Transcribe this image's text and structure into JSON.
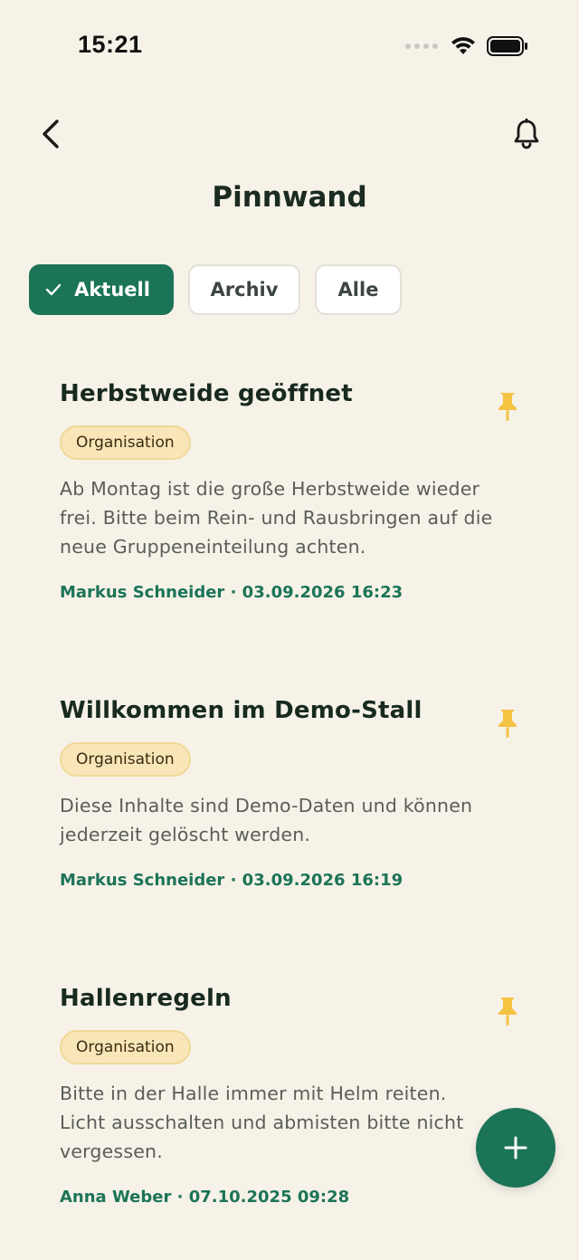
{
  "status_bar": {
    "time": "15:21"
  },
  "nav": {
    "title": "Pinnwand"
  },
  "filters": [
    {
      "label": "Aktuell",
      "selected": true
    },
    {
      "label": "Archiv",
      "selected": false
    },
    {
      "label": "Alle",
      "selected": false
    }
  ],
  "posts": [
    {
      "title": "Herbstweide geöffnet",
      "tag": "Organisation",
      "body": "Ab Montag ist die große Herbstweide wieder frei. Bitte beim Rein- und Rausbringen auf die neue Gruppeneinteilung achten.",
      "meta": "Markus Schneider · 03.09.2026 16:23",
      "pinned": true
    },
    {
      "title": "Willkommen im Demo-Stall",
      "tag": "Organisation",
      "body": "Diese Inhalte sind Demo-Daten und können jederzeit gelöscht werden.",
      "meta": "Markus Schneider · 03.09.2026 16:19",
      "pinned": true
    },
    {
      "title": "Hallenregeln",
      "tag": "Organisation",
      "body": "Bitte in der Halle immer mit Helm reiten. Licht ausschalten und abmisten bitte nicht vergessen.",
      "meta": "Anna Weber · 07.10.2025 09:28",
      "pinned": true
    }
  ],
  "colors": {
    "background": "#f6f2e7",
    "accent": "#1c7458",
    "pin": "#f5c342",
    "tag_bg": "#f8e6b8"
  },
  "icons": {
    "back": "chevron-left-icon",
    "bell": "bell-icon",
    "pin": "pushpin-icon",
    "check": "checkmark-icon",
    "fab": "plus-icon"
  }
}
